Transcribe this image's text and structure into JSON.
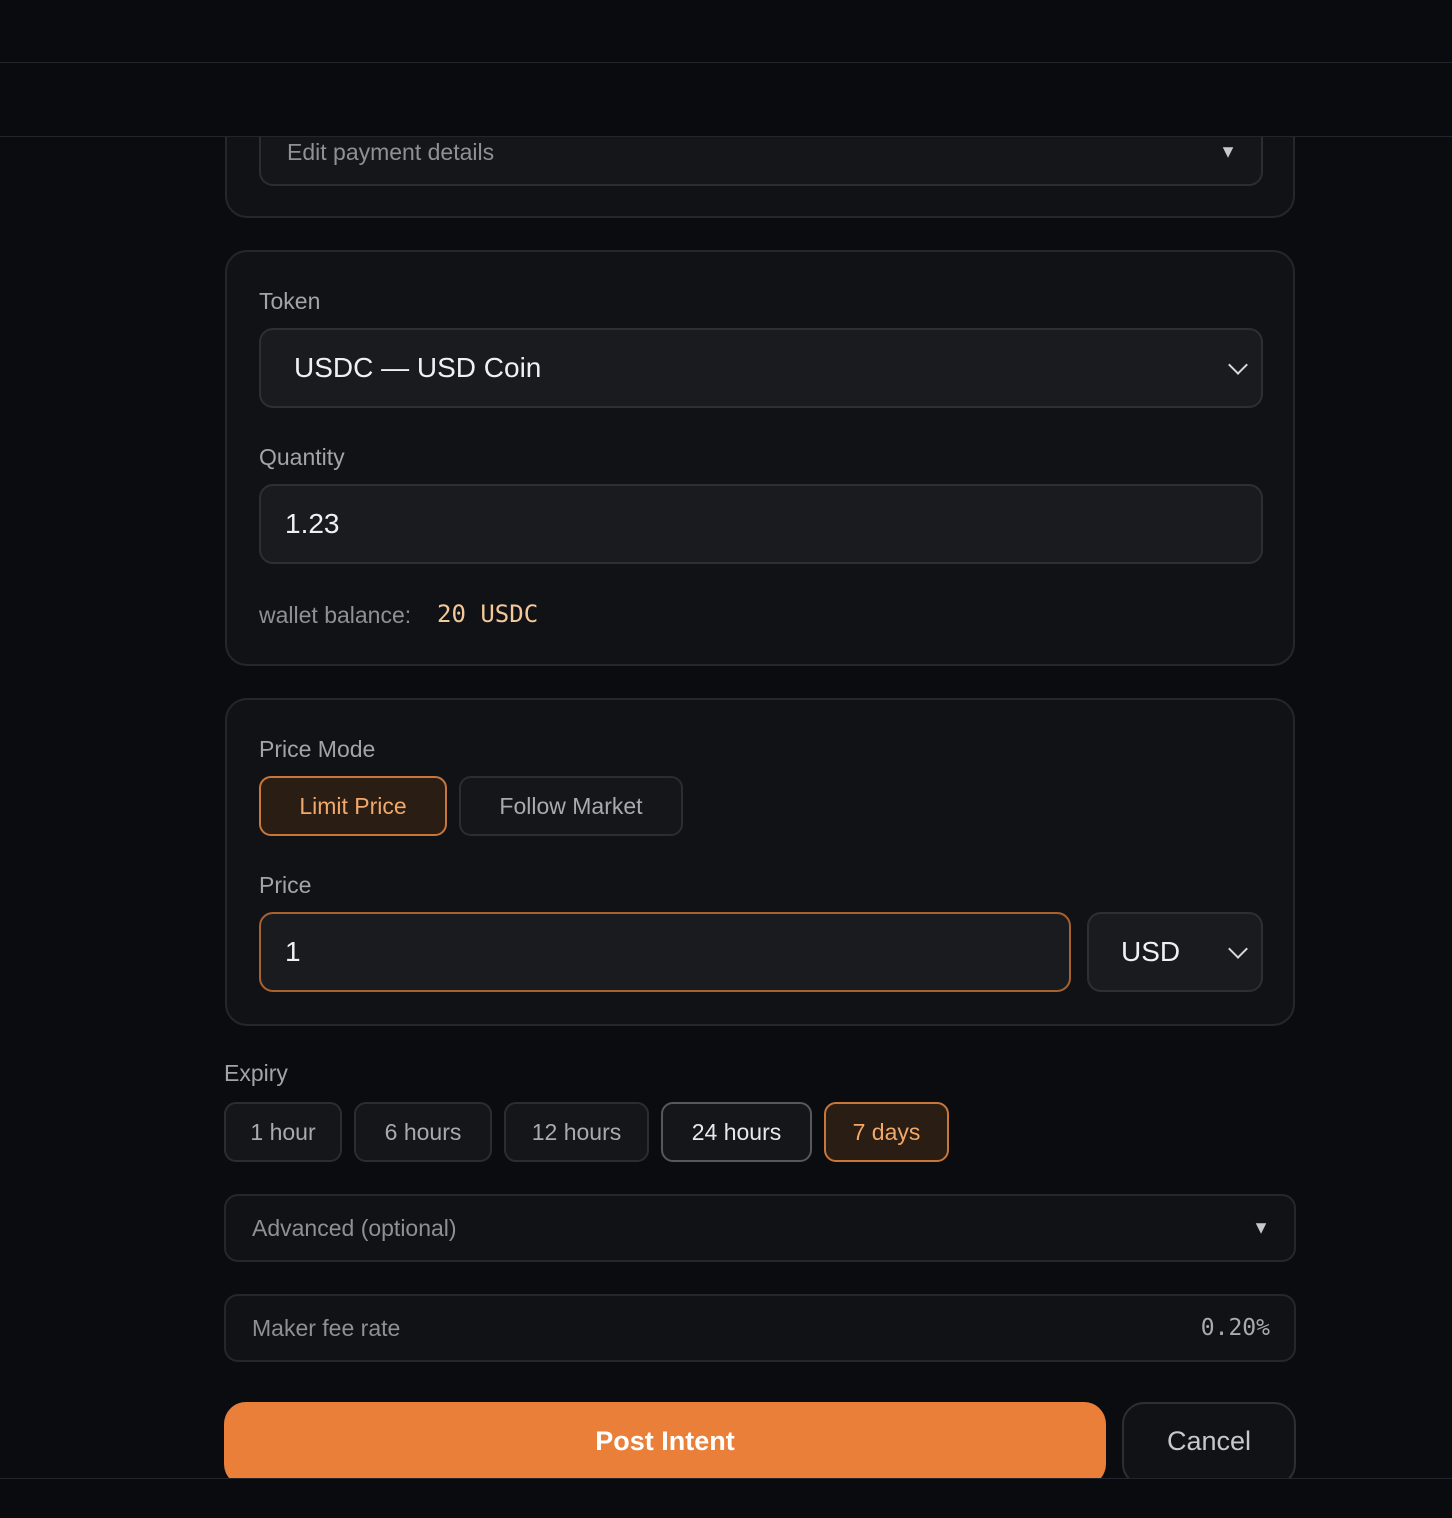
{
  "payment": {
    "edit_label": "Edit payment details",
    "toggle_icon": "triangle-down-icon"
  },
  "token": {
    "label": "Token",
    "selected": "USDC — USD Coin",
    "quantity_label": "Quantity",
    "quantity_value": "1.23",
    "balance_label": "wallet balance:",
    "balance_value": "20 USDC"
  },
  "price": {
    "mode_label": "Price Mode",
    "modes": [
      {
        "label": "Limit Price",
        "active": true
      },
      {
        "label": "Follow Market",
        "active": false
      }
    ],
    "price_label": "Price",
    "price_value": "1",
    "currency": "USD"
  },
  "expiry": {
    "label": "Expiry",
    "options": [
      {
        "label": "1 hour",
        "state": "default"
      },
      {
        "label": "6 hours",
        "state": "default"
      },
      {
        "label": "12 hours",
        "state": "default"
      },
      {
        "label": "24 hours",
        "state": "hover"
      },
      {
        "label": "7 days",
        "state": "active"
      }
    ]
  },
  "advanced": {
    "label": "Advanced (optional)"
  },
  "fee": {
    "label": "Maker fee rate",
    "value": "0.20%"
  },
  "actions": {
    "submit": "Post Intent",
    "cancel": "Cancel"
  },
  "colors": {
    "accent": "#ea7f3a",
    "accent_text": "#f2a868",
    "background": "#0b0c0f",
    "card": "#111216"
  }
}
